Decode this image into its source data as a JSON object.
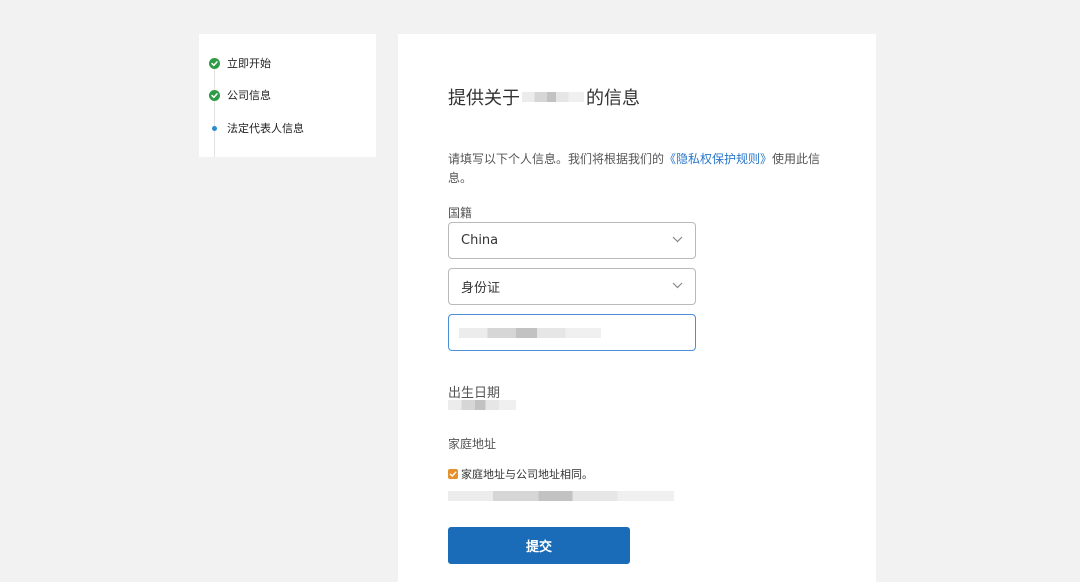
{
  "steps": [
    {
      "label": "立即开始",
      "state": "done"
    },
    {
      "label": "公司信息",
      "state": "done"
    },
    {
      "label": "法定代表人信息",
      "state": "current"
    }
  ],
  "form": {
    "title_prefix": "提供关于",
    "title_suffix": "的信息",
    "description_text": "请填写以下个人信息。我们将根据我们的",
    "description_link": "《隐私权保护规则》",
    "description_end": "使用此信息。",
    "nationality_label": "国籍",
    "nationality_value": "China",
    "id_type_value": "身份证",
    "birthdate_label": "出生日期",
    "address_label": "家庭地址",
    "same_address_label": "家庭地址与公司地址相同。",
    "same_address_checked": true,
    "submit_label": "提交"
  },
  "colors": {
    "done": "#2e9c47",
    "current": "#2a8ccf",
    "link": "#2a77c9",
    "checkbox": "#e5902a",
    "primary_button": "#1b6cb8"
  },
  "icons": {
    "done": "check-circle-icon",
    "current": "dot-icon",
    "dropdown": "chevron-down-icon",
    "checkbox": "checkmark-icon"
  }
}
